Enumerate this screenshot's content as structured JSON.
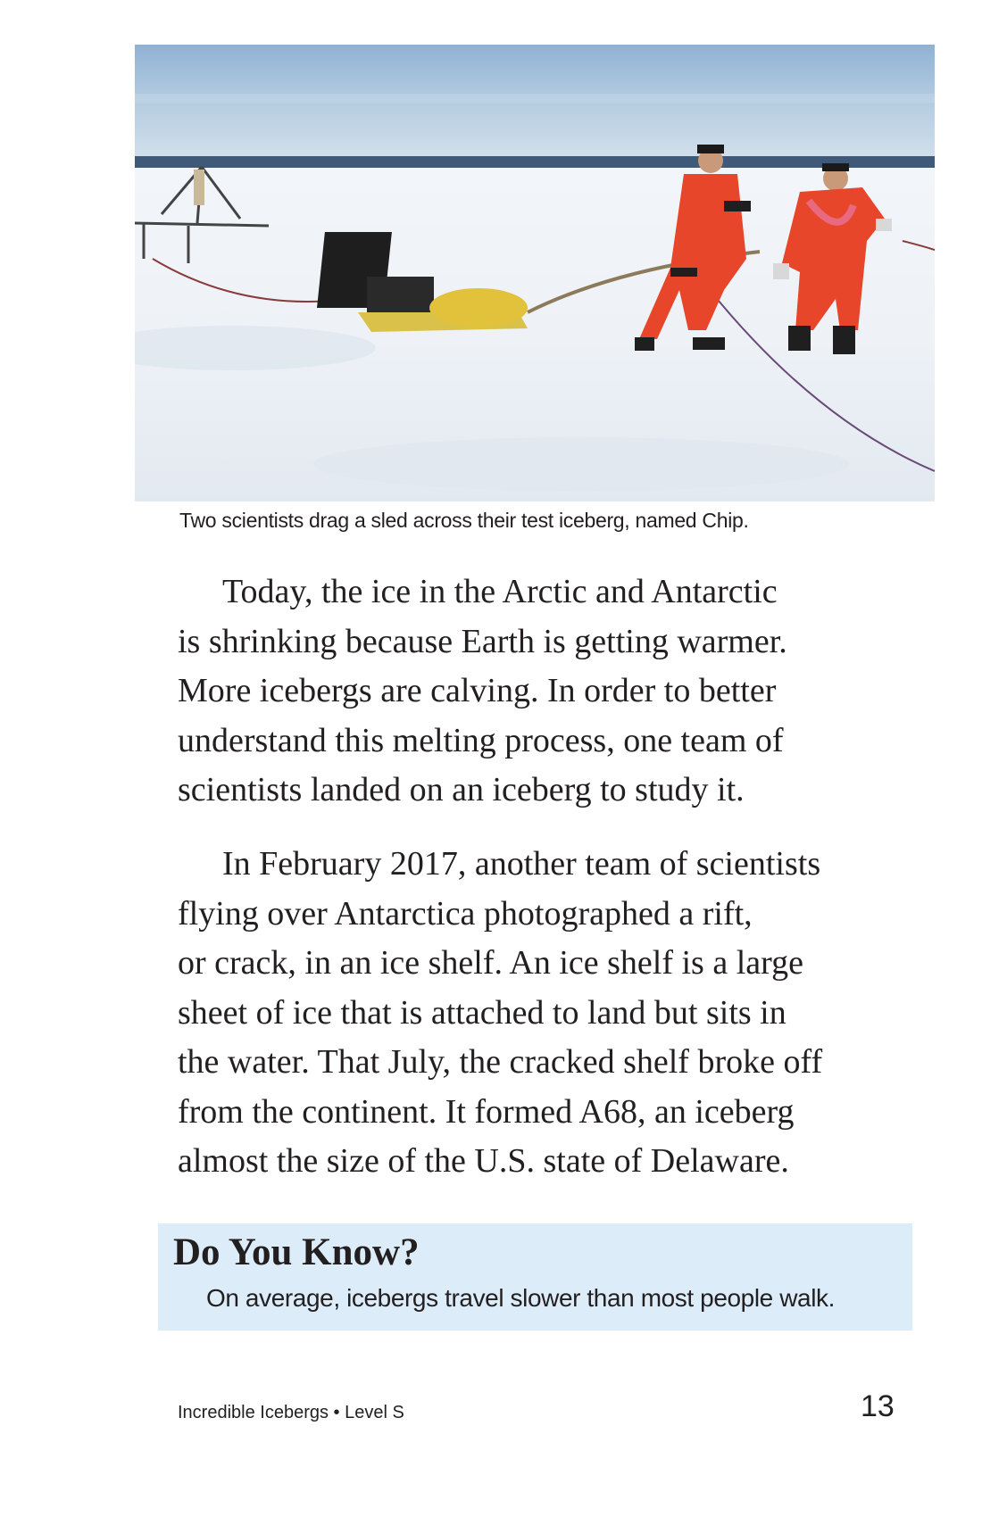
{
  "photo": {
    "description_icon": "photo-scientists-sled-icon"
  },
  "caption": "Two scientists drag a sled across their test iceberg, named Chip.",
  "paragraph1": {
    "lines": [
      "Today, the ice in the Arctic and Antarctic",
      "is shrinking because Earth is getting warmer.",
      "More icebergs are calving. In order to better",
      "understand this melting process, one team of",
      "scientists landed on an iceberg to study it."
    ]
  },
  "paragraph2": {
    "lines": [
      "In February 2017, another team of scientists",
      "flying over Antarctica photographed a rift,",
      "or crack, in an ice shelf. An ice shelf is a large",
      "sheet of ice that is attached to land but sits in",
      "the water. That July, the cracked shelf broke off",
      "from the continent. It formed A68, an iceberg",
      "almost the size of the U.S. state of Delaware."
    ]
  },
  "do_you_know": {
    "title": "Do You Know?",
    "text": "On average, icebergs travel slower than most people walk."
  },
  "footer": {
    "book": "Incredible Icebergs • Level S",
    "page_number": "13"
  },
  "colors": {
    "box_background": "#dcedf9",
    "text": "#231f20",
    "suit_orange": "#e8462a"
  }
}
